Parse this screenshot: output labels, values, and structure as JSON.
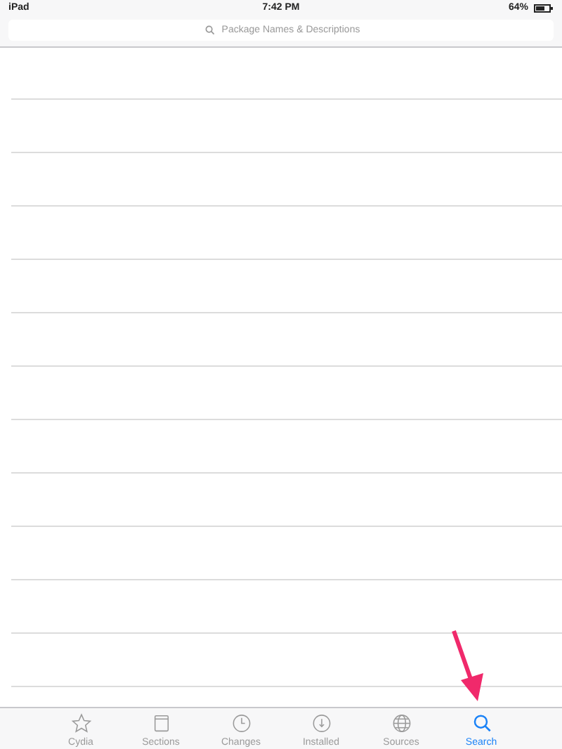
{
  "status_bar": {
    "device": "iPad",
    "time": "7:42 PM",
    "battery": "64%"
  },
  "search": {
    "placeholder": "Package Names & Descriptions"
  },
  "tabs": [
    {
      "label": "Cydia",
      "selected": false
    },
    {
      "label": "Sections",
      "selected": false
    },
    {
      "label": "Changes",
      "selected": false
    },
    {
      "label": "Installed",
      "selected": false
    },
    {
      "label": "Sources",
      "selected": false
    },
    {
      "label": "Search",
      "selected": true
    }
  ]
}
